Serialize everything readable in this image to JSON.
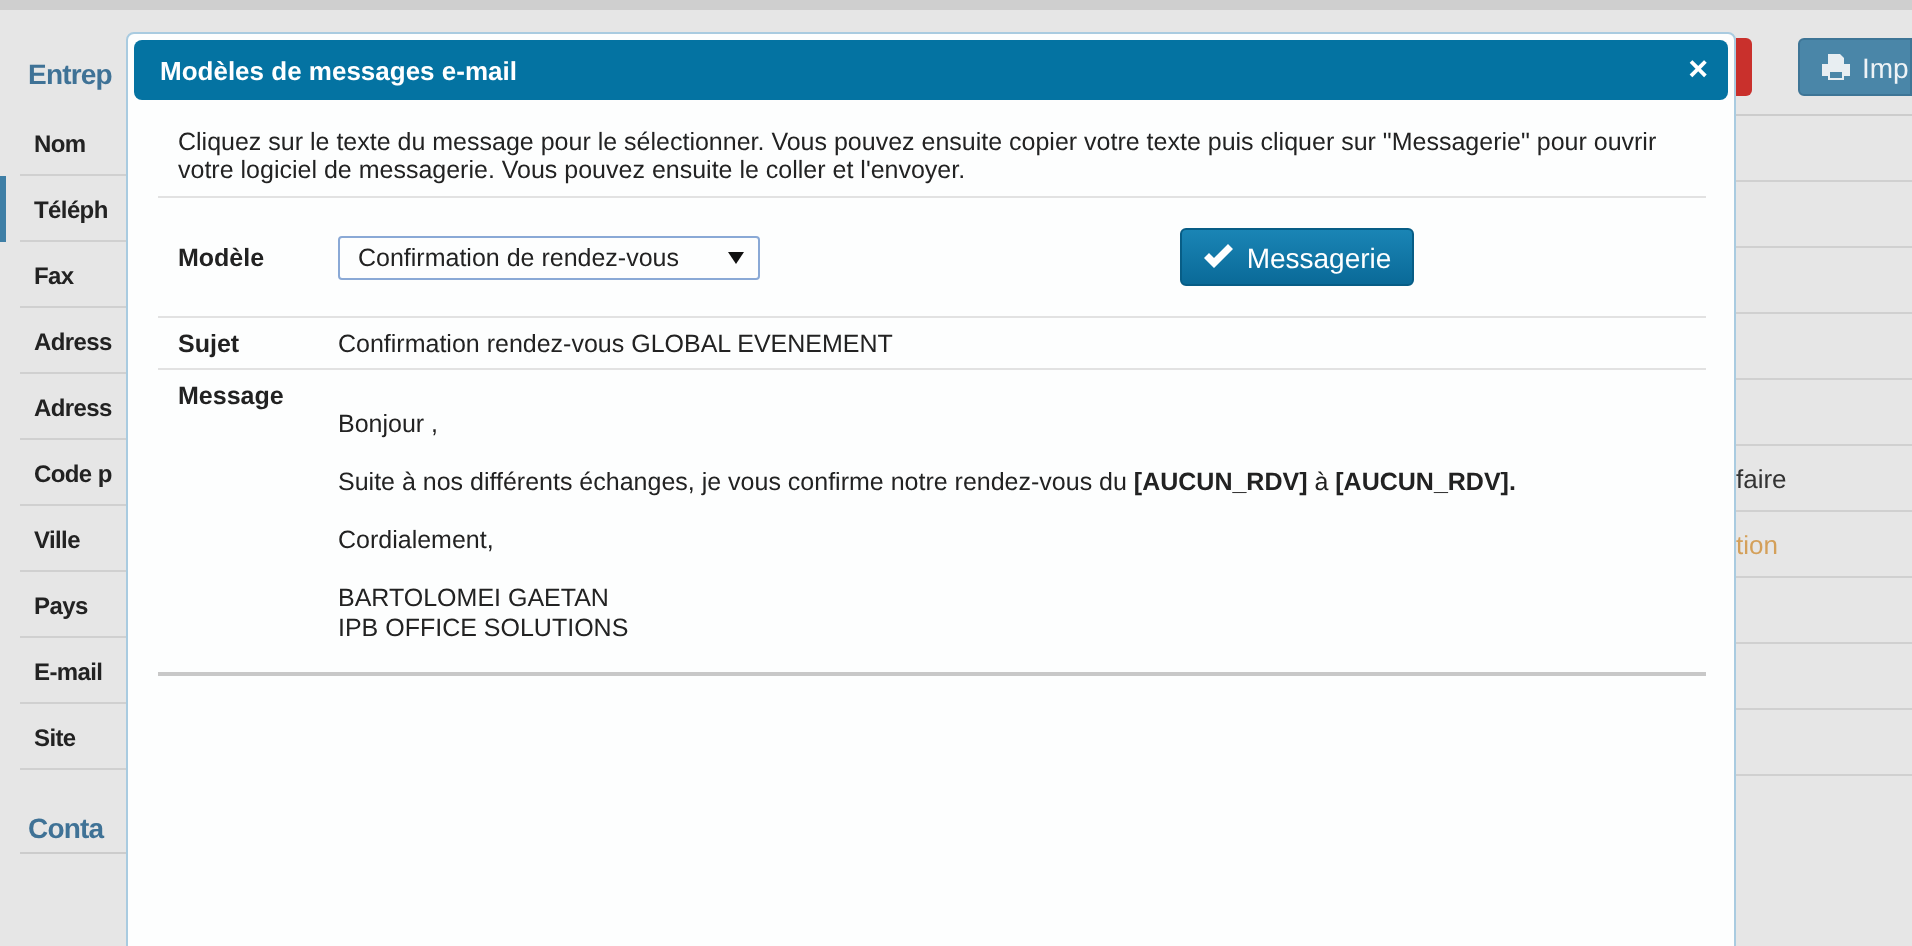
{
  "page": {
    "heading": "Entrep",
    "section_heading": "Conta",
    "print_button": "Imp",
    "rows": [
      {
        "label": "Nom",
        "selected": false
      },
      {
        "label": "Téléph",
        "selected": true
      },
      {
        "label": "Fax",
        "selected": false
      },
      {
        "label": "Adress",
        "selected": false
      },
      {
        "label": "Adress",
        "selected": false
      },
      {
        "label": "Code p",
        "selected": false,
        "value": "faire",
        "kind": "text"
      },
      {
        "label": "Ville",
        "selected": false,
        "value": "tion",
        "kind": "link"
      },
      {
        "label": "Pays",
        "selected": false
      },
      {
        "label": "E-mail",
        "selected": false
      },
      {
        "label": "Site",
        "selected": false
      }
    ]
  },
  "dialog": {
    "title": "Modèles de messages e-mail",
    "close": "×",
    "intro": "Cliquez sur le texte du message pour le sélectionner. Vous pouvez ensuite copier votre texte puis cliquer sur \"Messagerie\" pour ouvrir votre logiciel de messagerie. Vous pouvez ensuite le coller et l'envoyer.",
    "model_label": "Modèle",
    "model_value": "Confirmation de rendez-vous",
    "send_button": "Messagerie",
    "subject_label": "Sujet",
    "subject": "Confirmation rendez-vous GLOBAL EVENEMENT",
    "message_label": "Message",
    "message": [
      "Bonjour ,",
      "Suite à nos différents échanges, je vous confirme notre rendez-vous du **[AUCUN_RDV]** à **[AUCUN_RDV].**",
      "Cordialement,",
      "BARTOLOMEI GAETAN\nIPB OFFICE SOLUTIONS"
    ]
  }
}
